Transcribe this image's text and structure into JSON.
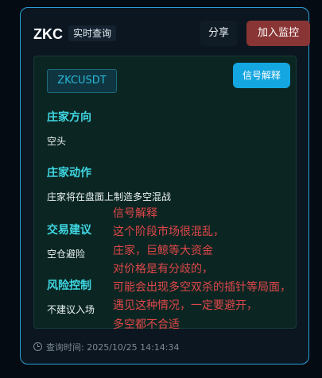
{
  "header": {
    "symbol": "ZKC",
    "tag": "实时查询",
    "share_label": "分享",
    "monitor_label": "加入监控"
  },
  "panel": {
    "pair": "ZKCUSDT",
    "explain_label": "信号解释",
    "sections": [
      {
        "title": "庄家方向",
        "text": "空头"
      },
      {
        "title": "庄家动作",
        "text": "庄家将在盘面上制造多空混战"
      },
      {
        "title": "交易建议",
        "text": "空仓避险"
      },
      {
        "title": "风险控制",
        "text": "不建议入场"
      }
    ]
  },
  "overlay": {
    "lines": [
      "信号解释",
      "这个阶段市场很混乱，",
      "庄家，巨鲸等大资金",
      "对价格是有分歧的，",
      "可能会出现多空双杀的插针等局面，",
      "遇见这种情况，一定要避开，",
      "多空都不合适"
    ]
  },
  "footer": {
    "query_time": "查询时间: 2025/10/25 14:14:34"
  },
  "colors": {
    "accent": "#2a9fd6",
    "section_title": "#3fd7e3",
    "monitor_button": "#8a3535",
    "explain_button": "#13a6e0",
    "overlay_text": "#e0464a"
  }
}
